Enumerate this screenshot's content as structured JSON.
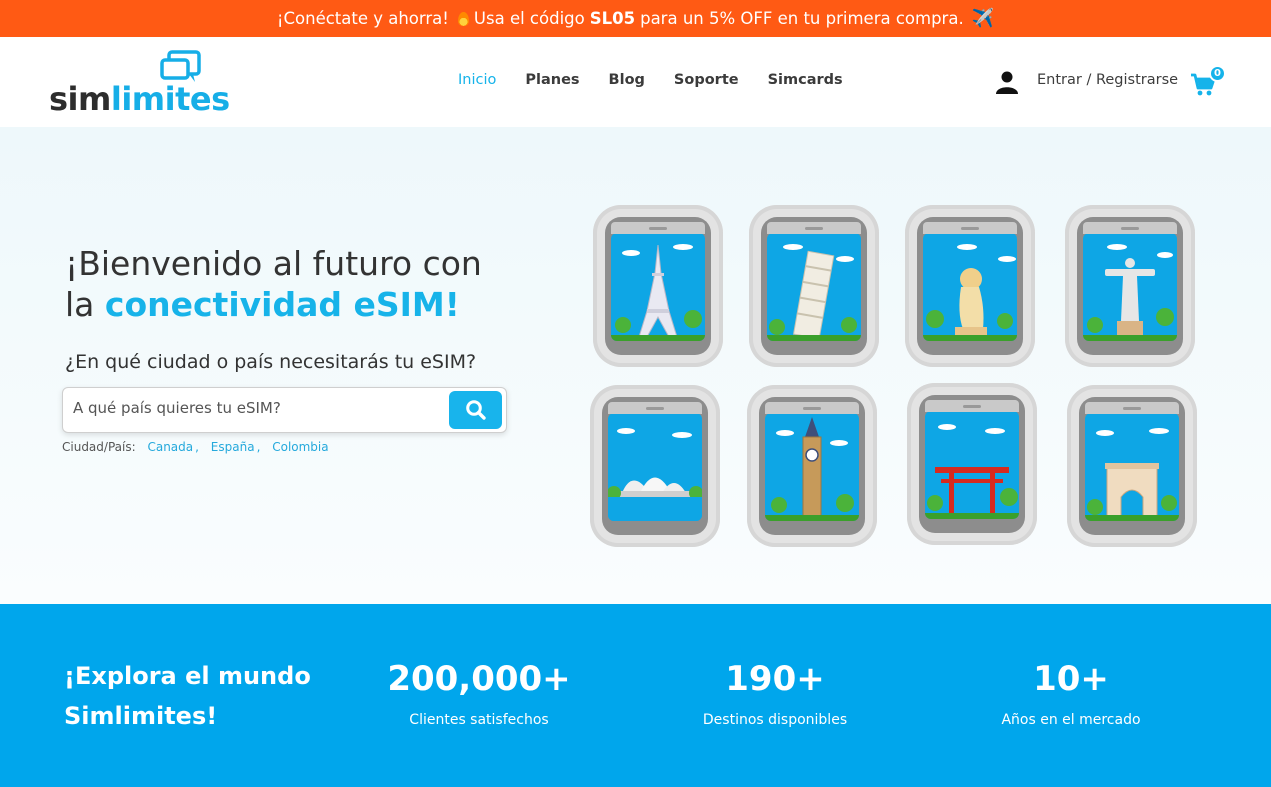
{
  "promo": {
    "text_before": "¡Conéctate y ahorra!",
    "text_middle": "Usa el código",
    "code": "SL05",
    "text_after": "para un 5% OFF en tu primera compra.",
    "plane_glyph": "✈️"
  },
  "header": {
    "logo": {
      "part1": "sim",
      "part2": "limites"
    },
    "nav": [
      {
        "label": "Inicio",
        "active": true
      },
      {
        "label": "Planes",
        "active": false
      },
      {
        "label": "Blog",
        "active": false
      },
      {
        "label": "Soporte",
        "active": false
      },
      {
        "label": "Simcards",
        "active": false
      }
    ],
    "login_label": "Entrar / Registrarse",
    "cart_count": "0"
  },
  "hero": {
    "title_line1": "¡Bienvenido al futuro con",
    "title_line2_prefix": "la",
    "title_highlight": "conectividad eSIM!",
    "question": "¿En qué ciudad o país necesitarás tu eSIM?",
    "search_placeholder": "A qué país quieres tu eSIM?",
    "cities_label": "Ciudad/País:",
    "cities": [
      "Canada",
      "España",
      "Colombia"
    ],
    "landmarks": [
      "eiffel-tower",
      "leaning-tower-pisa",
      "merlion",
      "christ-redeemer",
      "sydney-opera-house",
      "big-ben",
      "torii-gate",
      "arc-de-triomphe"
    ]
  },
  "stats": {
    "heading_line1": "¡Explora el mundo",
    "heading_line2": "Simlimites!",
    "items": [
      {
        "value": "200,000+",
        "label": "Clientes satisfechos"
      },
      {
        "value": "190+",
        "label": "Destinos disponibles"
      },
      {
        "value": "10+",
        "label": "Años en el mercado"
      }
    ]
  },
  "colors": {
    "promo_bg": "#ff5a14",
    "accent": "#16aee7",
    "stats_bg": "#00a6ec"
  }
}
